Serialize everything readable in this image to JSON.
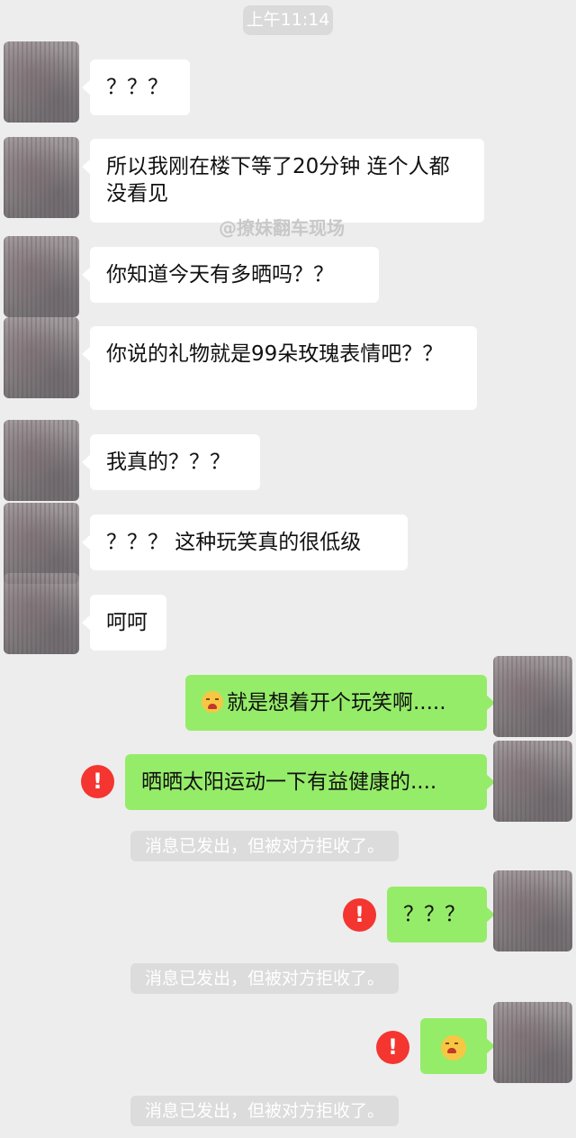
{
  "time": "上午11:14",
  "watermark": "@撩妹翻车现场",
  "incoming": [
    {
      "text": "？？？"
    },
    {
      "text": "所以我刚在楼下等了20分钟 连个人都没看见"
    },
    {
      "text": "你知道今天有多晒吗？？"
    },
    {
      "text": "你说的礼物就是99朵玫瑰表情吧？？"
    },
    {
      "text": "我真的？？？"
    },
    {
      "text": "？？？ 这种玩笑真的很低级"
    },
    {
      "text": "呵呵"
    }
  ],
  "outgoing": [
    {
      "emoji": "angry-face-emoji",
      "text": "就是想着开个玩笑啊.....",
      "failed": false
    },
    {
      "text": "晒晒太阳运动一下有益健康的....",
      "failed": true
    },
    {
      "text": "？？？",
      "failed": true
    },
    {
      "emoji": "angry-face-emoji",
      "text": "",
      "failed": true
    }
  ],
  "reject_notice": "消息已发出，但被对方拒收了。",
  "error_symbol": "!"
}
